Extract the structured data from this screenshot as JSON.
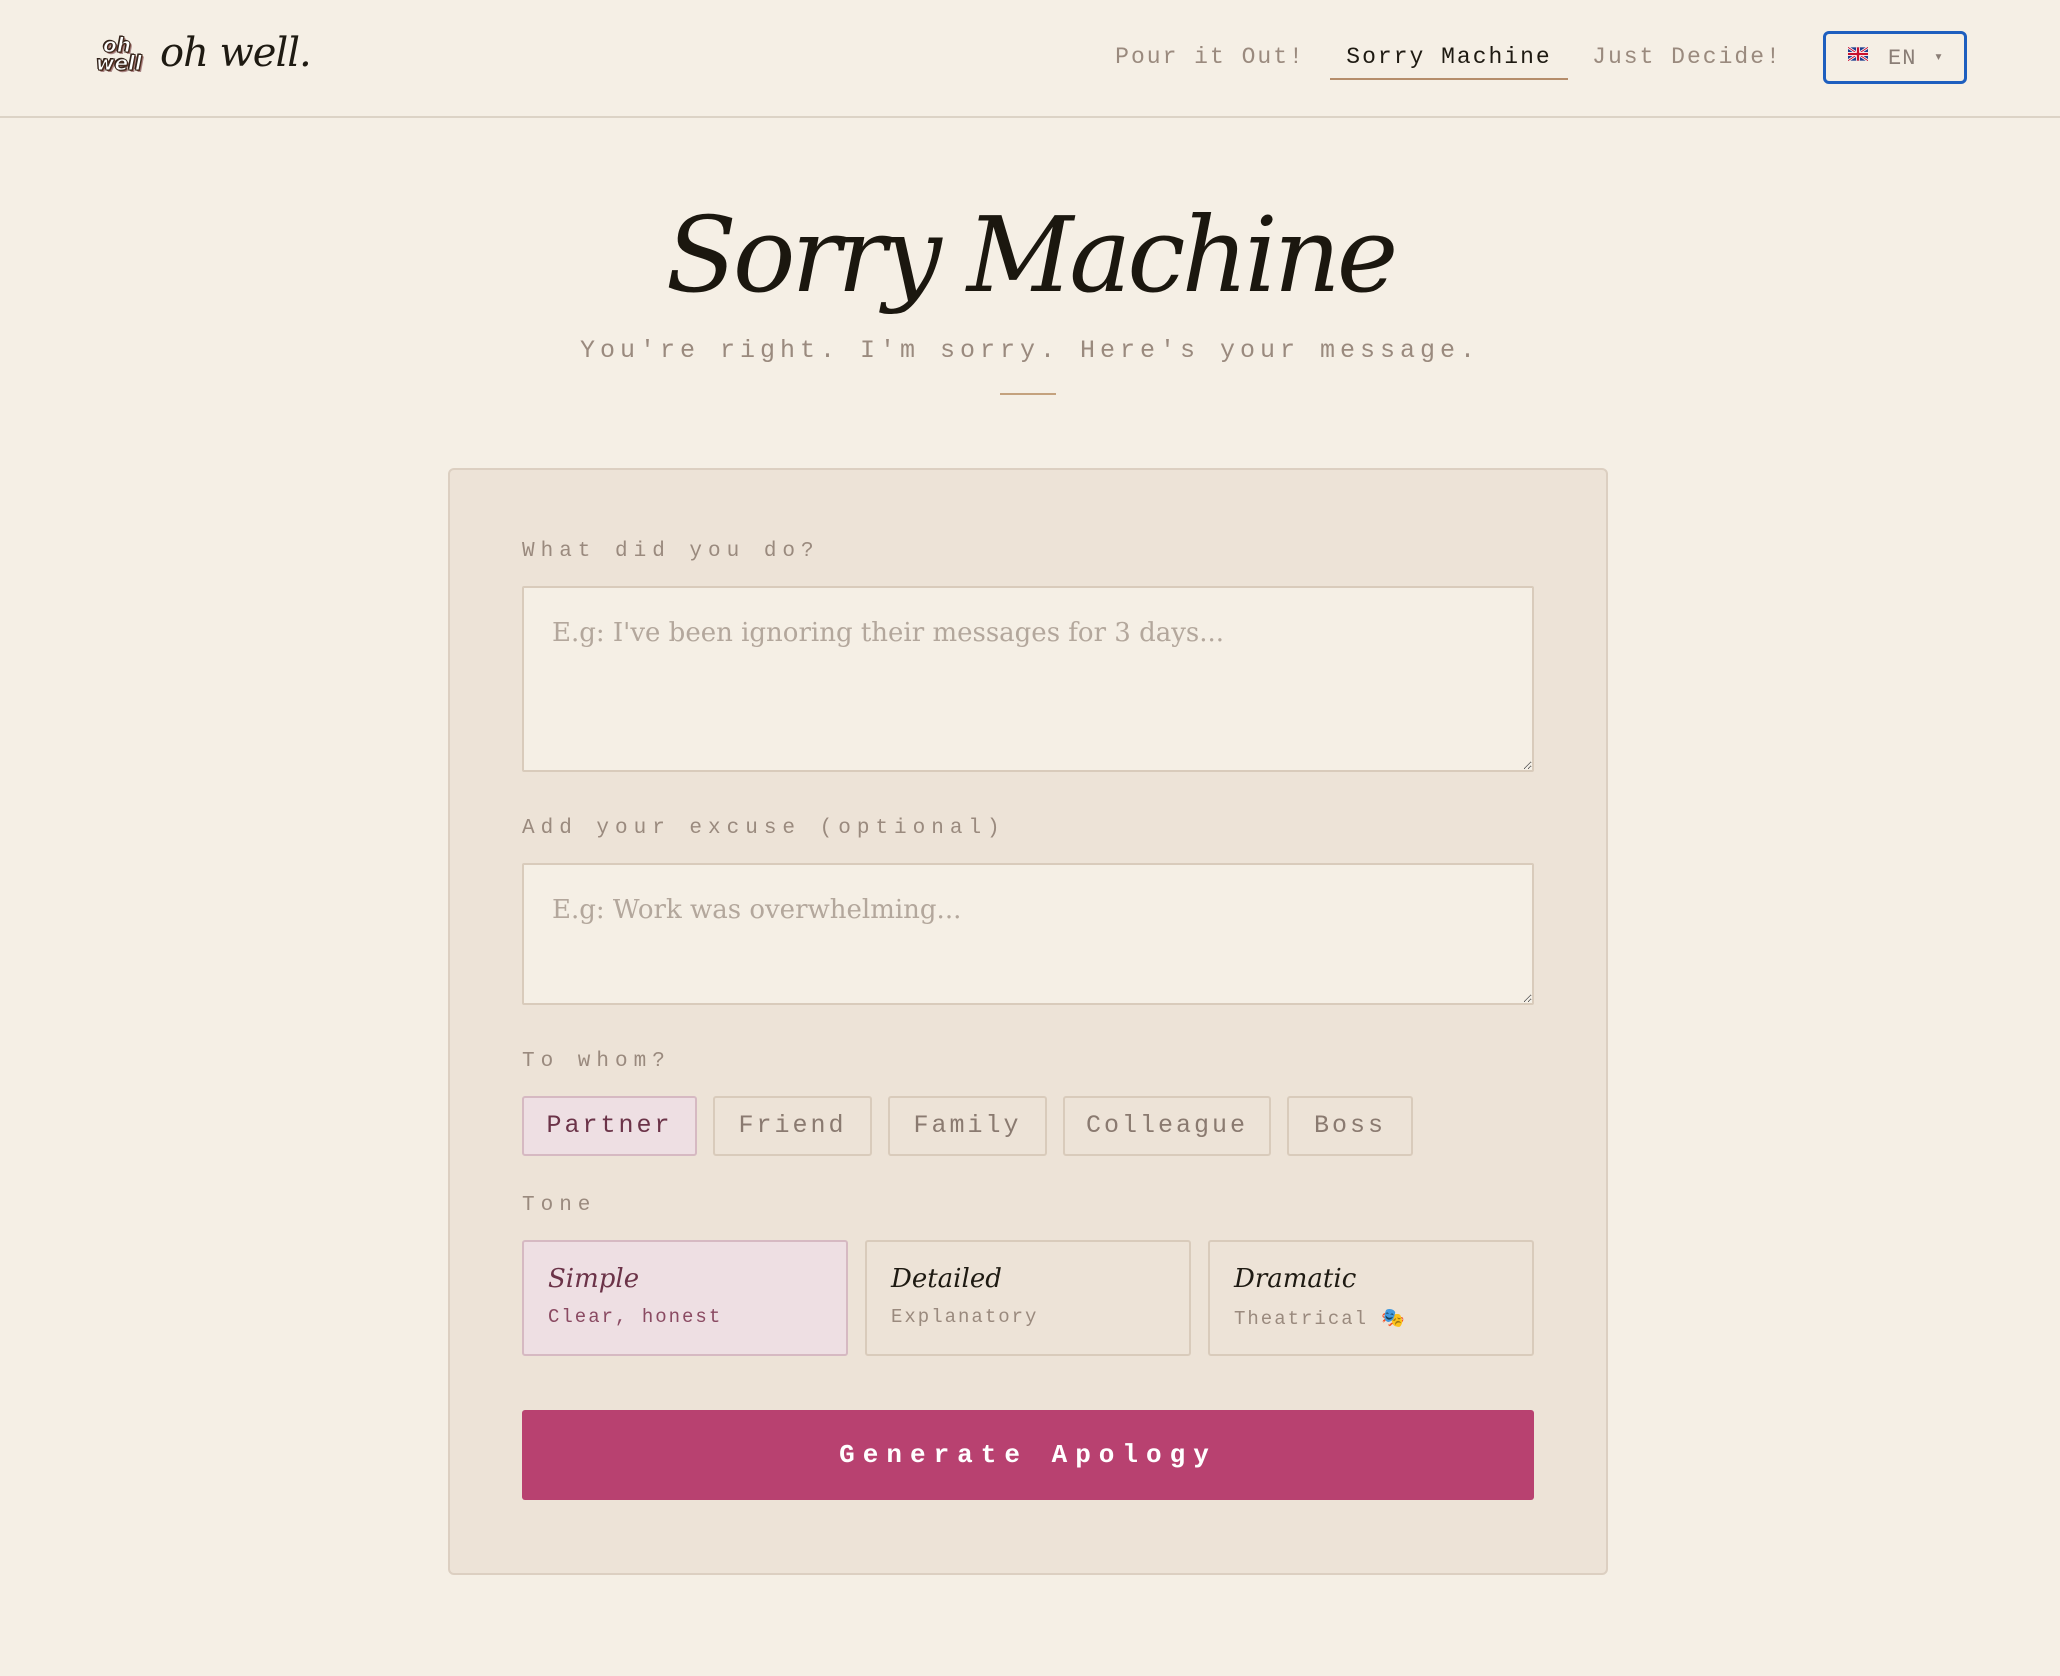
{
  "brand": {
    "logo_mark": "oh well",
    "name": "oh well."
  },
  "nav": {
    "items": [
      {
        "label": "Pour it Out!"
      },
      {
        "label": "Sorry Machine"
      },
      {
        "label": "Just Decide!"
      }
    ],
    "language": {
      "label": "EN",
      "flag": "uk-flag-icon",
      "caret": "▾"
    }
  },
  "hero": {
    "title": "Sorry Machine",
    "subtitle": "You're right. I'm sorry. Here's your message."
  },
  "form": {
    "what_label": "What did you do?",
    "what_placeholder": "E.g: I've been ignoring their messages for 3 days...",
    "what_value": "",
    "excuse_label": "Add your excuse (optional)",
    "excuse_placeholder": "E.g: Work was overwhelming...",
    "excuse_value": "",
    "whom_label": "To whom?",
    "recipients": [
      {
        "label": "Partner",
        "selected": true
      },
      {
        "label": "Friend",
        "selected": false
      },
      {
        "label": "Family",
        "selected": false
      },
      {
        "label": "Colleague",
        "selected": false
      },
      {
        "label": "Boss",
        "selected": false
      }
    ],
    "tone_label": "Tone",
    "tones": [
      {
        "name": "Simple",
        "desc": "Clear, honest",
        "selected": true
      },
      {
        "name": "Detailed",
        "desc": "Explanatory",
        "selected": false
      },
      {
        "name": "Dramatic",
        "desc": "Theatrical 🎭",
        "selected": false
      }
    ],
    "submit_label": "Generate Apology"
  },
  "colors": {
    "background": "#f5efe5",
    "card": "#ede3d7",
    "accent": "#b84170",
    "selected_fill": "#eedfe3",
    "focus_ring": "#1e5fbf"
  }
}
